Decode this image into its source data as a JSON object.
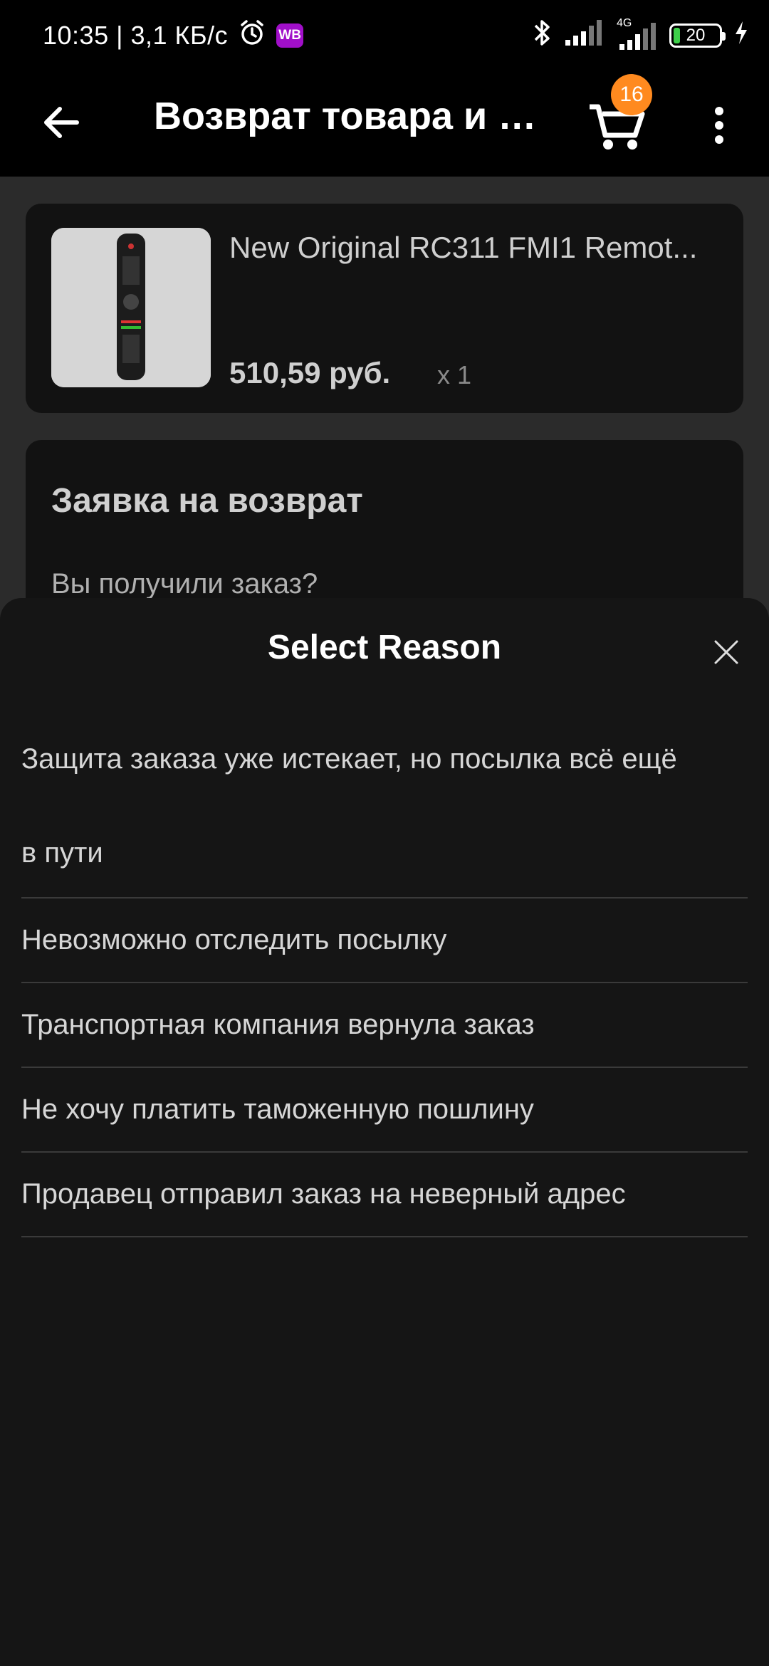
{
  "status_bar": {
    "time": "10:35 | 3,1 КБ/с",
    "wb_label": "WB",
    "network": "4G",
    "battery": "20"
  },
  "app_bar": {
    "title": "Возврат товара и д...",
    "cart_count": "16"
  },
  "product": {
    "name": "New Original RC311 FMI1 Remot...",
    "price": "510,59 руб.",
    "quantity": "x 1"
  },
  "return_request": {
    "title": "Заявка на возврат",
    "question": "Вы получили заказ?"
  },
  "sheet": {
    "title": "Select Reason",
    "reasons": [
      {
        "line1": "Защита заказа уже истекает, но посылка всё ещё",
        "line2": "в пути"
      },
      {
        "label": "Невозможно отследить посылку"
      },
      {
        "label": "Транспортная компания вернула заказ"
      },
      {
        "label": "Не хочу платить таможенную пошлину"
      },
      {
        "label": "Продавец отправил заказ на неверный адрес"
      }
    ]
  },
  "colors": {
    "cart_badge": "#ff8a1f",
    "wb_badge": "#a10fc9",
    "battery_fill": "#3ecf4a",
    "sheet_bg": "#151515",
    "divider": "#3a3a3a"
  }
}
